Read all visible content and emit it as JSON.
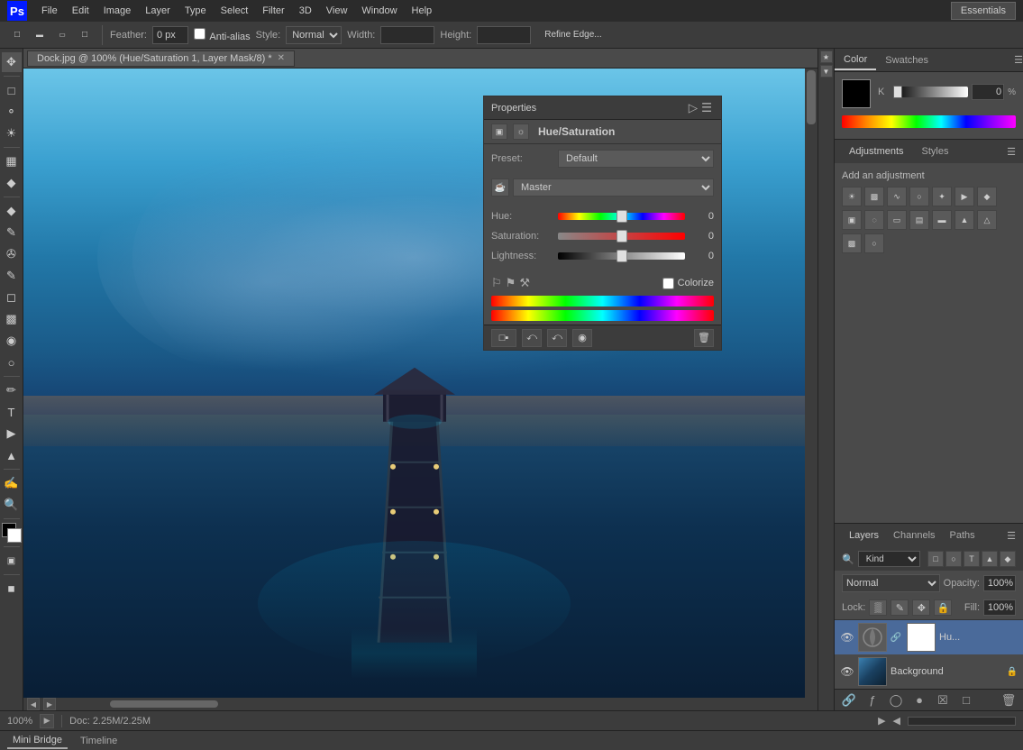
{
  "app": {
    "title": "Photoshop",
    "logo": "Ps"
  },
  "menubar": {
    "items": [
      "File",
      "Edit",
      "Image",
      "Layer",
      "Type",
      "Select",
      "Filter",
      "3D",
      "View",
      "Window",
      "Help"
    ]
  },
  "toolbar": {
    "feather_label": "Feather:",
    "feather_value": "0 px",
    "anti_alias_label": "Anti-alias",
    "style_label": "Style:",
    "style_value": "Normal",
    "width_label": "Width:",
    "height_label": "Height:",
    "refine_edge": "Refine Edge...",
    "essentials": "Essentials"
  },
  "document": {
    "tab_title": "Dock.jpg @ 100% (Hue/Saturation 1, Layer Mask/8) *"
  },
  "properties_panel": {
    "title": "Properties",
    "subtitle": "Hue/Saturation",
    "preset_label": "Preset:",
    "preset_value": "Default",
    "channel_label": "Master",
    "hue_label": "Hue:",
    "hue_value": "0",
    "saturation_label": "Saturation:",
    "saturation_value": "0",
    "lightness_label": "Lightness:",
    "lightness_value": "0",
    "colorize_label": "Colorize",
    "hue_slider_pos": "50",
    "sat_slider_pos": "50",
    "light_slider_pos": "50"
  },
  "color_panel": {
    "tab1": "Color",
    "tab2": "Swatches",
    "channel_label": "K",
    "channel_value": "0",
    "channel_pct": "%"
  },
  "adjustments_panel": {
    "title": "Adjustments",
    "tab1": "Adjustments",
    "tab2": "Styles",
    "section_title": "Add an adjustment"
  },
  "layers_panel": {
    "tab1": "Layers",
    "tab2": "Channels",
    "tab3": "Paths",
    "search_kind": "Kind",
    "blend_mode": "Normal",
    "opacity_label": "Opacity:",
    "opacity_value": "100%",
    "lock_label": "Lock:",
    "fill_label": "Fill:",
    "fill_value": "100%",
    "layers": [
      {
        "name": "Hu...",
        "type": "adjustment",
        "visible": true,
        "has_mask": true
      },
      {
        "name": "Background",
        "type": "image",
        "visible": true,
        "locked": true
      }
    ]
  },
  "status_bar": {
    "zoom": "100%",
    "doc_size": "Doc: 2.25M/2.25M"
  },
  "bottom_bar": {
    "tab1": "Mini Bridge",
    "tab2": "Timeline"
  }
}
